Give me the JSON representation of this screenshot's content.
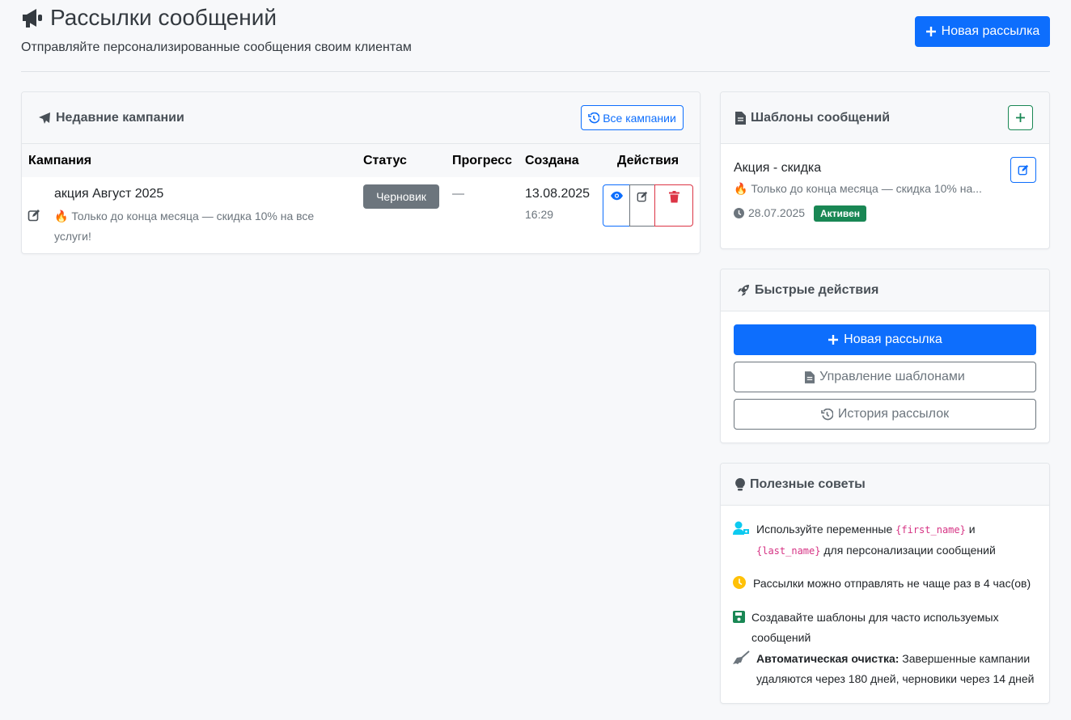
{
  "header": {
    "title": "Рассылки сообщений",
    "subtitle": "Отправляйте персонализированные сообщения своим клиентам",
    "new_button": "Новая рассылка"
  },
  "recent": {
    "title": "Недавние кампании",
    "all_button": "Все кампании",
    "columns": [
      "Кампания",
      "Статус",
      "Прогресс",
      "Создана",
      "Действия"
    ],
    "rows": [
      {
        "name": "акция Август 2025",
        "preview": "🔥 Только до конца месяца — скидка 10% на все услуги!",
        "status": "Черновик",
        "progress": "—",
        "date": "13.08.2025",
        "time": "16:29"
      }
    ]
  },
  "templates": {
    "title": "Шаблоны сообщений",
    "items": [
      {
        "name": "Акция - скидка",
        "preview": "🔥 Только до конца месяца — скидка 10% на...",
        "date": "28.07.2025",
        "status": "Активен"
      }
    ]
  },
  "quick": {
    "title": "Быстрые действия",
    "new": "Новая рассылка",
    "manage": "Управление шаблонами",
    "history": "История рассылок"
  },
  "tips": {
    "title": "Полезные советы",
    "t1_a": "Используйте переменные",
    "t1_var1": "{first_name}",
    "t1_and": "и",
    "t1_var2": "{last_name}",
    "t1_b": "для персонализации сообщений",
    "t2": "Рассылки можно отправлять не чаще раз в 4 час(ов)",
    "t3": "Создавайте шаблоны для часто используемых сообщений",
    "t4_bold": "Автоматическая очистка:",
    "t4": "Завершенные кампании удаляются через 180 дней, черновики через 14 дней"
  },
  "colors": {
    "primary": "#0d6efd",
    "success": "#198754",
    "danger": "#dc3545",
    "secondary": "#6c757d"
  }
}
